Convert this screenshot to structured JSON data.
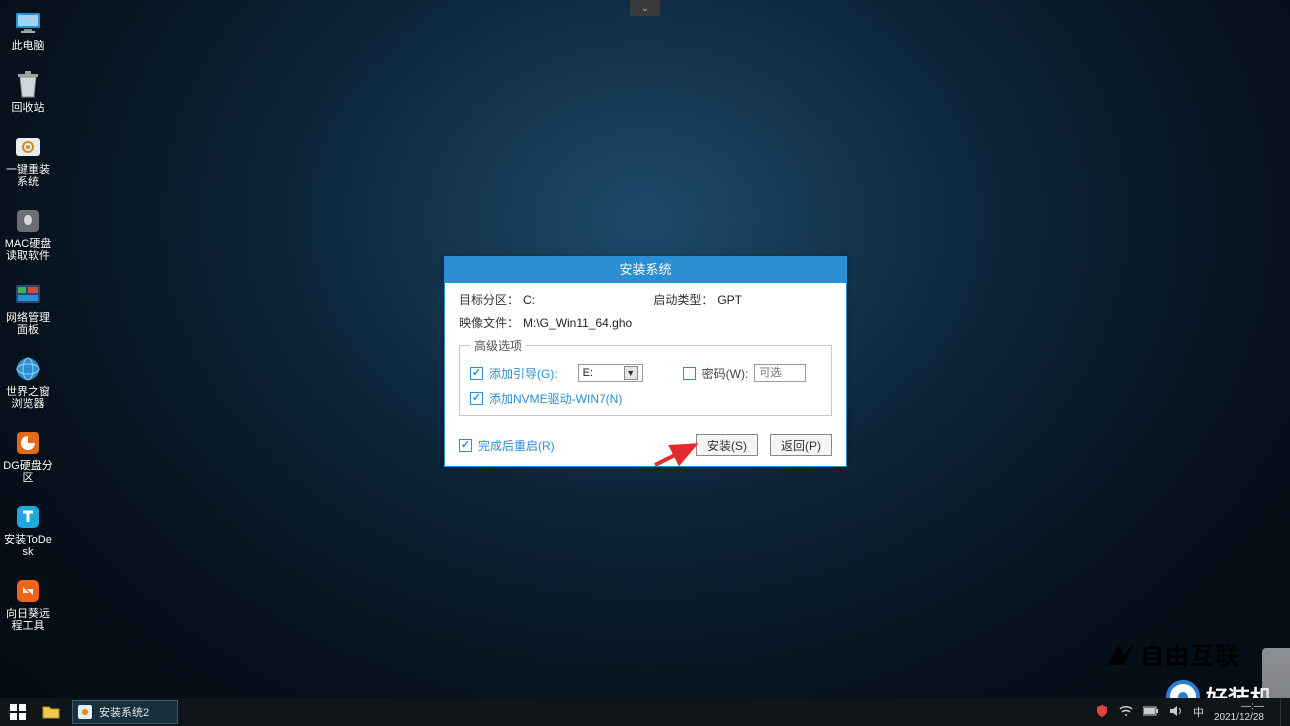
{
  "top_tab_glyph": "⌄",
  "desktop_icons": [
    {
      "id": "this-pc",
      "label": "此电脑"
    },
    {
      "id": "recycle-bin",
      "label": "回收站"
    },
    {
      "id": "one-key-install",
      "label": "一键重装系统"
    },
    {
      "id": "mac-disk-reader",
      "label": "MAC硬盘读取软件"
    },
    {
      "id": "net-panel",
      "label": "网络管理面板"
    },
    {
      "id": "world-browser",
      "label": "世界之窗浏览器"
    },
    {
      "id": "dg-partition",
      "label": "DG硬盘分区"
    },
    {
      "id": "install-todesk",
      "label": "安装ToDesk"
    },
    {
      "id": "sunflower-remote",
      "label": "向日葵远程工具"
    }
  ],
  "dialog": {
    "title": "安装系统",
    "target_partition_label": "目标分区：",
    "target_partition_value": "C:",
    "boot_type_label": "启动类型：",
    "boot_type_value": "GPT",
    "image_file_label": "映像文件：",
    "image_file_value": "M:\\G_Win11_64.gho",
    "advanced_legend": "高级选项",
    "add_boot_label": "添加引导(G):",
    "add_boot_checked": true,
    "add_boot_select_value": "E:",
    "password_label": "密码(W):",
    "password_checked": false,
    "password_placeholder": "可选",
    "add_nvme_label": "添加NVME驱动-WIN7(N)",
    "add_nvme_checked": true,
    "reboot_after_label": "完成后重启(R)",
    "reboot_after_checked": true,
    "install_btn": "安装(S)",
    "return_btn": "返回(P)"
  },
  "taskbar": {
    "app_title": "安装系统2",
    "ime": "中",
    "time": "—:—",
    "date": "2021/12/28"
  },
  "watermarks": {
    "wm1": "自由互联",
    "wm2": "好装机"
  }
}
